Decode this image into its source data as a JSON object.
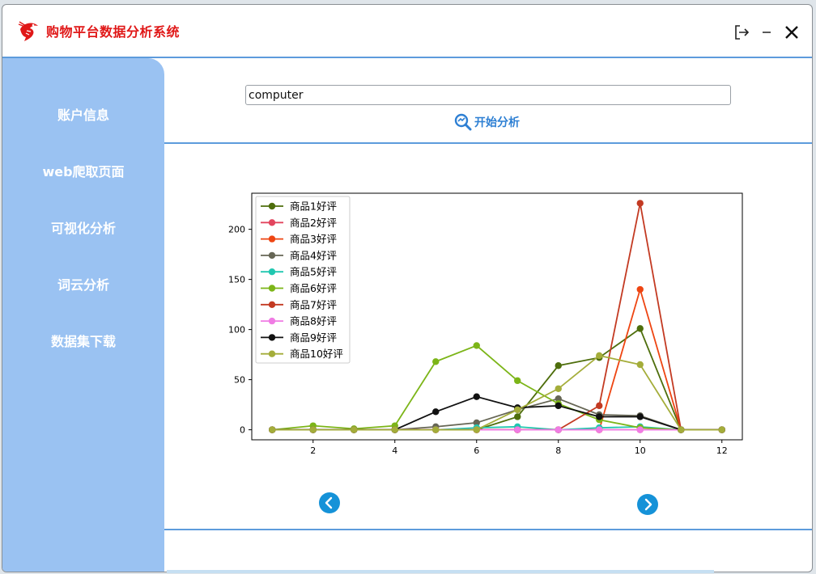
{
  "app": {
    "title": "购物平台数据分析系统",
    "logo_icon": "shrimp-logo-icon",
    "accent_color": "#e01818",
    "sidebar_color": "#9ac2f2",
    "line_color": "#5d9bdc"
  },
  "window_controls": {
    "logout_icon": "logout-icon",
    "minimize_icon": "minimize-icon",
    "close_icon": "close-icon"
  },
  "sidebar": {
    "items": [
      {
        "label": "账户信息"
      },
      {
        "label": "web爬取页面"
      },
      {
        "label": "可视化分析"
      },
      {
        "label": "词云分析"
      },
      {
        "label": "数据集下载"
      }
    ]
  },
  "search": {
    "value": "computer"
  },
  "analyze_button": {
    "label": "开始分析",
    "icon": "search-analyze-icon"
  },
  "pager": {
    "prev_icon": "chevron-left-icon",
    "next_icon": "chevron-right-icon"
  },
  "chart_data": {
    "type": "line",
    "x": [
      1,
      2,
      3,
      4,
      5,
      6,
      7,
      8,
      9,
      10,
      11,
      12
    ],
    "xlim": [
      0.5,
      12.5
    ],
    "ylim": [
      -10,
      236
    ],
    "xticks": [
      2,
      4,
      6,
      8,
      10,
      12
    ],
    "yticks": [
      0,
      50,
      100,
      150,
      200
    ],
    "legend_position": "top-left",
    "grid": false,
    "series": [
      {
        "name": "商品1好评",
        "color": "#4e6e0c",
        "values": [
          0,
          0,
          0,
          0,
          0,
          0,
          13,
          64,
          72,
          101,
          0,
          0
        ]
      },
      {
        "name": "商品2好评",
        "color": "#e2455e",
        "values": [
          0,
          0,
          0,
          0,
          0,
          0,
          0,
          0,
          0,
          0,
          0,
          0
        ]
      },
      {
        "name": "商品3好评",
        "color": "#ee4512",
        "values": [
          0,
          0,
          0,
          0,
          0,
          0,
          0,
          0,
          0,
          140,
          0,
          0
        ]
      },
      {
        "name": "商品4好评",
        "color": "#666655",
        "values": [
          0,
          0,
          0,
          0,
          3,
          7,
          20,
          31,
          15,
          14,
          0,
          0
        ]
      },
      {
        "name": "商品5好评",
        "color": "#20c7b0",
        "values": [
          0,
          0,
          0,
          0,
          0,
          2,
          3,
          0,
          2,
          3,
          0,
          0
        ]
      },
      {
        "name": "商品6好评",
        "color": "#7cb518",
        "values": [
          0,
          4,
          1,
          4,
          68,
          84,
          49,
          26,
          10,
          2,
          0,
          0
        ]
      },
      {
        "name": "商品7好评",
        "color": "#c33a22",
        "values": [
          0,
          0,
          0,
          0,
          0,
          0,
          0,
          0,
          24,
          226,
          0,
          0
        ]
      },
      {
        "name": "商品8好评",
        "color": "#f07ce4",
        "values": [
          0,
          0,
          0,
          0,
          0,
          0,
          0,
          0,
          0,
          0,
          0,
          0
        ]
      },
      {
        "name": "商品9好评",
        "color": "#111111",
        "values": [
          0,
          0,
          0,
          0,
          18,
          33,
          22,
          24,
          13,
          13,
          0,
          0
        ]
      },
      {
        "name": "商品10好评",
        "color": "#a4ad3a",
        "values": [
          0,
          0,
          0,
          0,
          0,
          0,
          20,
          41,
          74,
          65,
          0,
          0
        ]
      }
    ]
  }
}
